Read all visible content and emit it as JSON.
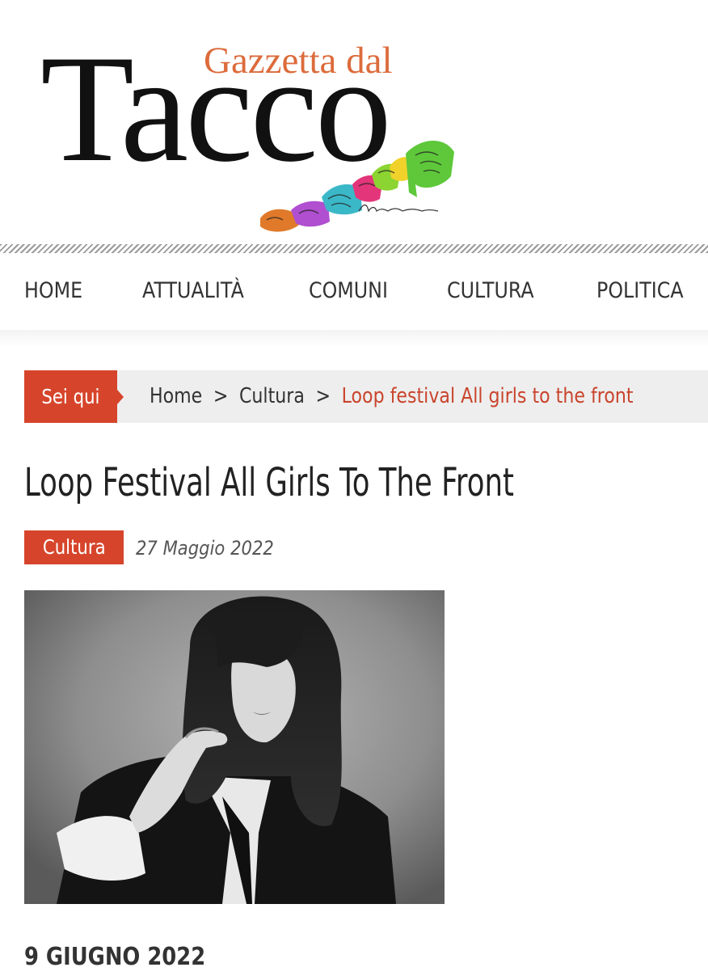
{
  "site": {
    "logo_main": "Tacco",
    "logo_sub": "Gazzetta dal",
    "colors": {
      "accent": "#d6452b",
      "logo_orange": "#dc6b3c"
    }
  },
  "nav": {
    "items": [
      {
        "label": "HOME"
      },
      {
        "label": "ATTUALITÀ"
      },
      {
        "label": "COMUNI"
      },
      {
        "label": "CULTURA"
      },
      {
        "label": "POLITICA"
      }
    ]
  },
  "breadcrumb": {
    "prefix": "Sei qui",
    "items": [
      {
        "label": "Home"
      },
      {
        "label": "Cultura"
      }
    ],
    "separator": ">",
    "current": "Loop festival All girls to the front"
  },
  "article": {
    "title": "Loop Festival All Girls To The Front",
    "category": "Cultura",
    "date": "27 Maggio 2022",
    "event_date": "9 GIUGNO 2022"
  }
}
